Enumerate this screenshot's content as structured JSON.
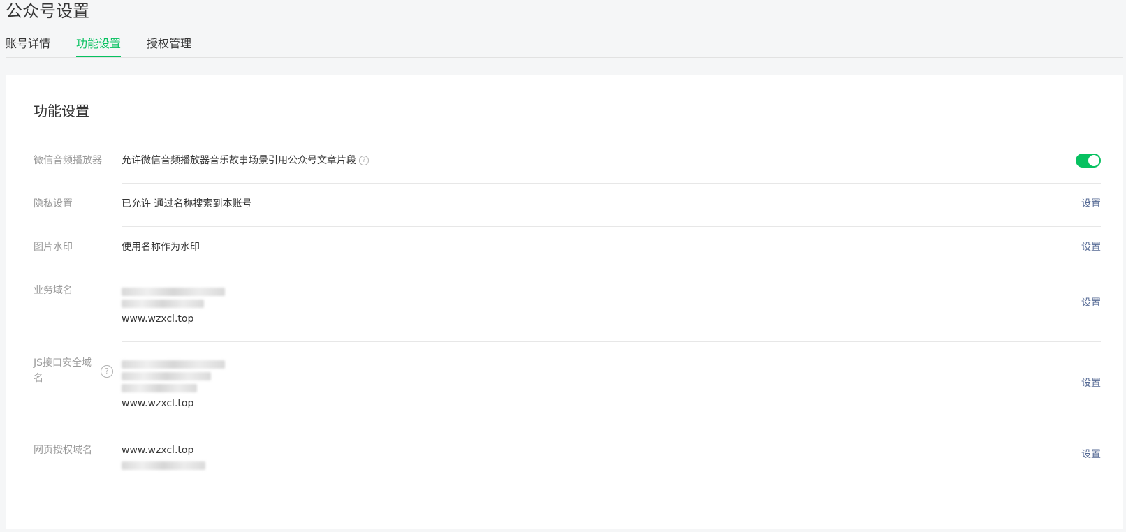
{
  "page": {
    "title": "公众号设置"
  },
  "tabs": [
    {
      "label": "账号详情",
      "active": false
    },
    {
      "label": "功能设置",
      "active": true
    },
    {
      "label": "授权管理",
      "active": false
    }
  ],
  "card": {
    "title": "功能设置"
  },
  "rows": {
    "audio_player": {
      "label": "微信音频播放器",
      "content": "允许微信音频播放器音乐故事场景引用公众号文章片段",
      "toggle_on": true
    },
    "privacy": {
      "label": "隐私设置",
      "content": "已允许 通过名称搜索到本账号",
      "action": "设置"
    },
    "watermark": {
      "label": "图片水印",
      "content": "使用名称作为水印",
      "action": "设置"
    },
    "business_domain": {
      "label": "业务域名",
      "domain_visible": "www.wzxcl.top",
      "action": "设置"
    },
    "js_domain": {
      "label": "JS接口安全域名",
      "domain_visible": "www.wzxcl.top",
      "action": "设置"
    },
    "web_auth_domain": {
      "label": "网页授权域名",
      "domain_visible": "www.wzxcl.top",
      "action": "设置"
    }
  },
  "colors": {
    "accent_green": "#07c160",
    "link_blue": "#576b95",
    "label_gray": "#9a9a9a"
  }
}
